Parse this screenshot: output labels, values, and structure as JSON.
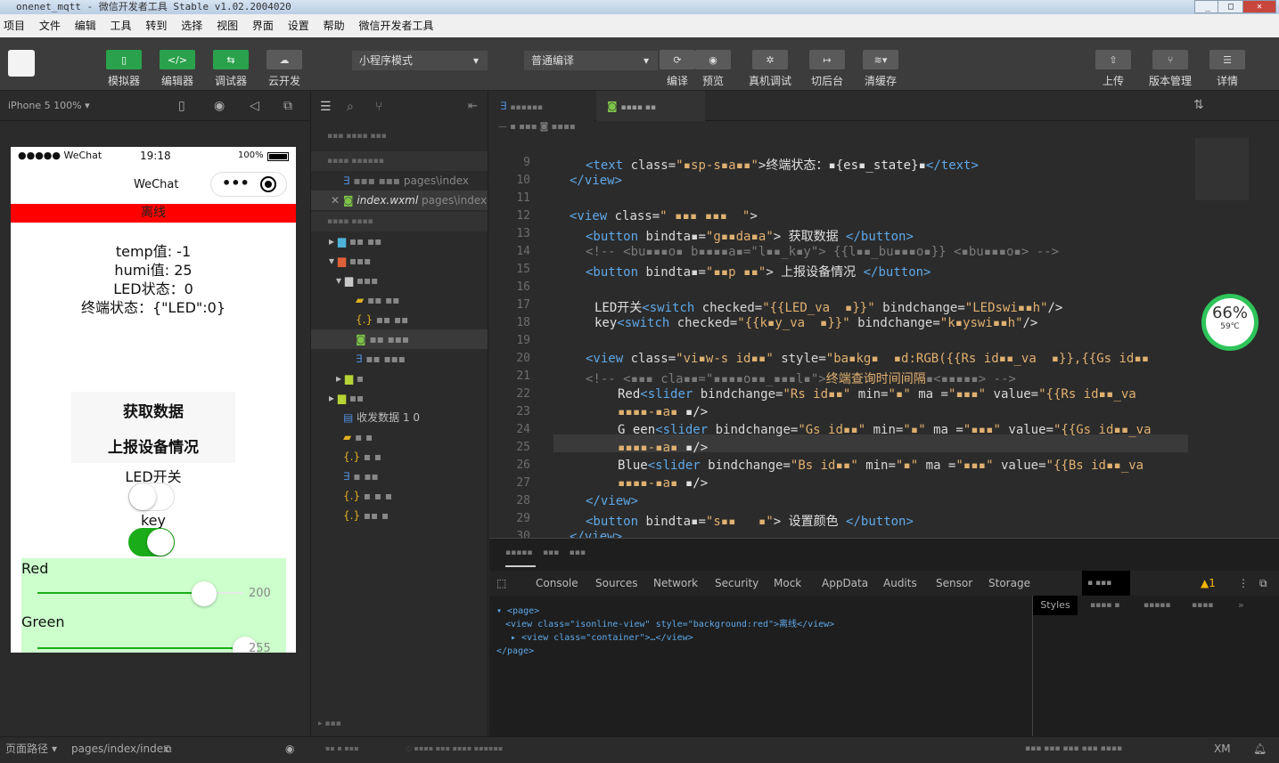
{
  "window": {
    "title": "onenet_mqtt - 微信开发者工具 Stable v1.02.2004020"
  },
  "menu": [
    "项目",
    "文件",
    "编辑",
    "工具",
    "转到",
    "选择",
    "视图",
    "界面",
    "设置",
    "帮助",
    "微信开发者工具"
  ],
  "toolbar": {
    "simulator": "模拟器",
    "editor": "编辑器",
    "debugger": "调试器",
    "cloud": "云开发",
    "mode": "小程序模式",
    "compile": "普通编译",
    "compile_btn": "编译",
    "preview": "预览",
    "realdebug": "真机调试",
    "background": "切后台",
    "cache": "清缓存",
    "upload": "上传",
    "version": "版本管理",
    "details": "详情"
  },
  "sim": {
    "device": "iPhone 5 100%",
    "carrier": "●●●●● WeChat",
    "time": "19:18",
    "battery": "100%",
    "nav_title": "WeChat",
    "banner": "离线",
    "temp": "temp值: -1",
    "humi": "humi值: 25",
    "led_state": "LED状态：0",
    "term_state": "终端状态：{\"LED\":0}",
    "get_btn": "获取数据",
    "report_btn": "上报设备情况",
    "led_label": "LED开关",
    "key_label": "key",
    "red_label": "Red",
    "red_value": "200",
    "green_label": "Green",
    "green_value": "255"
  },
  "explorer": {
    "file1_path": "pages\\index",
    "file2_name": "index.wxml",
    "file2_path": "pages\\index",
    "file3": "收发数据 1 0"
  },
  "code": {
    "lines": [
      "9",
      "10",
      "11",
      "12",
      "13",
      "14",
      "15",
      "16",
      "17",
      "18",
      "19",
      "20",
      "21",
      "22",
      "23",
      "24",
      "25",
      "26",
      "27",
      "28",
      "29",
      "30"
    ]
  },
  "devtools": {
    "tabs": [
      "Console",
      "Sources",
      "Network",
      "Security",
      "Mock",
      "AppData",
      "Audits",
      "Sensor",
      "Storage"
    ],
    "warn_count": "1",
    "dom1": "<page>",
    "dom2": "<view class=\"isonline-view\" style=\"background:red\">离线</view>",
    "dom3": "<view class=\"container\">…</view>",
    "dom4": "</page>",
    "styles_tab": "Styles"
  },
  "status": {
    "path_label": "页面路径",
    "path": "pages/index/index",
    "right": "XM"
  },
  "perf": {
    "percent": "66%",
    "temp": "59℃"
  }
}
